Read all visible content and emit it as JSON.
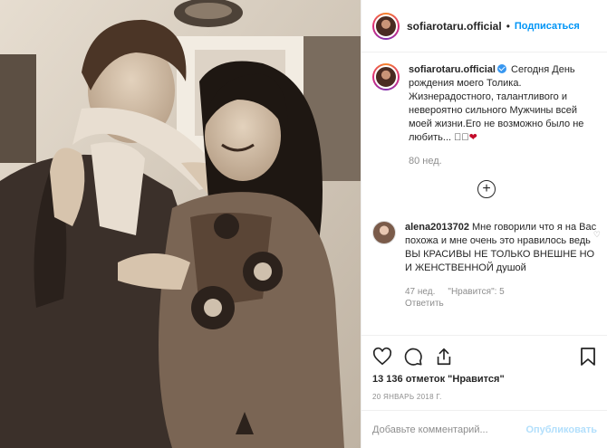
{
  "header": {
    "username": "sofiarotaru.official",
    "separator": "•",
    "follow_label": "Подписаться"
  },
  "caption": {
    "username": "sofiarotaru.official",
    "text": "Сегодня День рождения моего Толика. Жизнерадостного, талантливого и невероятно сильного Мужчины всей моей жизни.Его не возможно было не любить... 🏻🏻",
    "heart": "❤",
    "time": "80 нед."
  },
  "more_comments": {
    "symbol": "+"
  },
  "comment": {
    "username": "alena2013702",
    "text": "Мне говорили что я на Вас похожа и мне очень это нравилось ведь ВЫ КРАСИВЫ НЕ ТОЛЬКО ВНЕШНЕ НО И ЖЕНСТВЕННОЙ душой",
    "time": "47 нед.",
    "likes": "\"Нравится\": 5",
    "reply": "Ответить",
    "heart": "♡"
  },
  "actions": {
    "likes_text": "13 136 отметок \"Нравится\"",
    "date": "20 ЯНВАРЬ 2018 Г.",
    "icons": [
      "heart-icon",
      "comment-icon",
      "share-icon",
      "bookmark-icon"
    ]
  },
  "add_comment": {
    "placeholder": "Добавьте комментарий...",
    "publish_label": "Опубликовать"
  },
  "colors": {
    "accent": "#0095f6",
    "publish_disabled": "#b2dffc",
    "muted": "#8e8e8e"
  }
}
